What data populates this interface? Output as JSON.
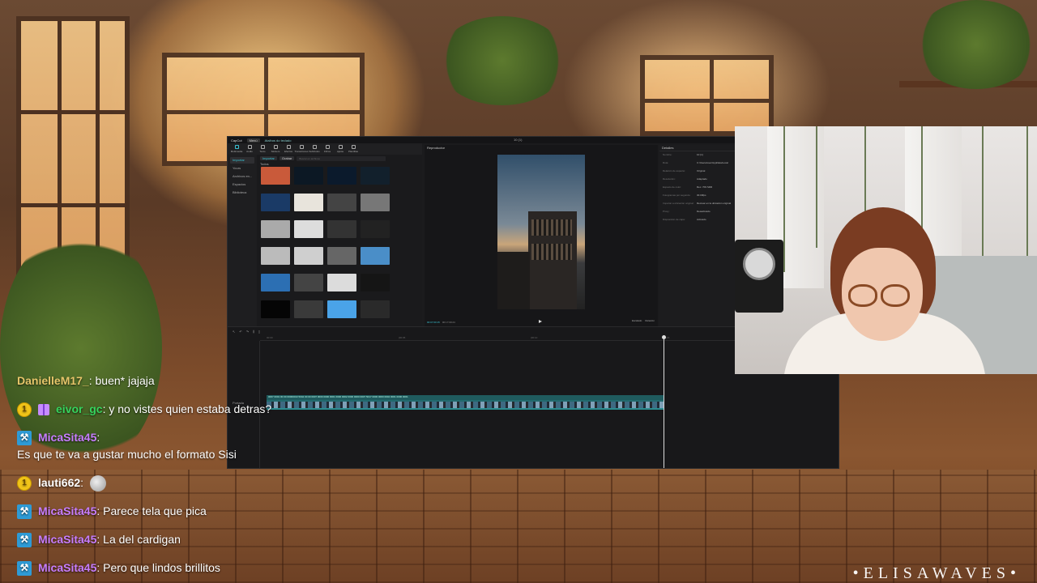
{
  "editor": {
    "app_name": "CapCut",
    "menu_label": "Menú",
    "project_name": "Atalhos do teclado",
    "window_title": "10 (1)",
    "toolbar": [
      "Multimedia",
      "Audio",
      "Texto",
      "Stickers",
      "Efectos",
      "Transiciones",
      "Subtítulos",
      "Filtros",
      "Ajuste",
      "Plantillas"
    ],
    "sidebar": [
      "Importar",
      "Yours",
      "Archivos en...",
      "Espacios",
      "Biblioteca"
    ],
    "media_chips": [
      "Importar",
      "Grabar"
    ],
    "search_placeholder": "Buscar en archivos",
    "media_folder": "Todos",
    "thumb_colors": [
      "#c95a3a",
      "#0c1824",
      "#0b1a2c",
      "#12202c",
      "#1a3a66",
      "#e8e4dc",
      "#444",
      "#777",
      "#aaa",
      "#ddd",
      "#333",
      "#222",
      "#bbb",
      "#cfcfcf",
      "#666",
      "#4a8ec8",
      "#2c6fb3",
      "#444",
      "#dcdcdc",
      "#151515",
      "#050505",
      "#3a3a3a",
      "#4aa3e8",
      "#2a2a2a"
    ],
    "player_title": "Reproductor",
    "player_time_current": "00:07:00:15",
    "player_time_total": "00:17:00:24",
    "player_right": [
      "Escalado",
      "Relación"
    ],
    "details_title": "Detalles",
    "details": [
      {
        "k": "Nombre:",
        "v": "10 (1)"
      },
      {
        "k": "Ruta:",
        "v": "C:/Users/user/AppData/Local"
      },
      {
        "k": "Relación de aspecto:",
        "v": "Original"
      },
      {
        "k": "Resolución:",
        "v": "Adaptado"
      },
      {
        "k": "Espacio de color:",
        "v": "Rec. 709 SDR"
      },
      {
        "k": "Fotogramas por segundo:",
        "v": "30.00fps"
      },
      {
        "k": "Importar a ubicación original:",
        "v": "Recrear en la ubicación original"
      },
      {
        "k": "Proxy:",
        "v": "Desactivado"
      },
      {
        "k": "Disposición de capa:",
        "v": "Activado"
      }
    ],
    "timeline_ruler": [
      "00:00",
      "|00:05",
      "|00:10",
      "|00:15",
      "|00:20"
    ],
    "track_caption": "0007 0001 00 00 00000013 5042 00 00 0007 0000 0000 0001 0000 0002 0000 0000 0007 5017 0000 0000 0002 0001 0000 0001",
    "track_label": "Portada"
  },
  "chat": [
    {
      "user": "DanielleM17_",
      "user_color": "#e6c56a",
      "badges": [],
      "text": "buen* jajaja"
    },
    {
      "user": "eivor_gc",
      "user_color": "#36d35d",
      "badges": [
        "coin",
        "gift"
      ],
      "coin_value": "1",
      "text": "y no vistes quien estaba detras?"
    },
    {
      "user": "MicaSita45",
      "user_color": "#c77dff",
      "badges": [
        "hammer"
      ],
      "text": "Es que te va a gustar mucho el formato Sisi"
    },
    {
      "user": "lauti662",
      "user_color": "#ffffff",
      "badges": [
        "coin"
      ],
      "coin_value": "1",
      "text": "",
      "emote": "cat-emote"
    },
    {
      "user": "MicaSita45",
      "user_color": "#c77dff",
      "badges": [
        "hammer"
      ],
      "text": "Parece tela que pica"
    },
    {
      "user": "MicaSita45",
      "user_color": "#c77dff",
      "badges": [
        "hammer"
      ],
      "text": "La del cardigan"
    },
    {
      "user": "MicaSita45",
      "user_color": "#c77dff",
      "badges": [
        "hammer"
      ],
      "text": "Pero que lindos brillitos"
    }
  ],
  "watermark": "•ELISAWAVES•"
}
